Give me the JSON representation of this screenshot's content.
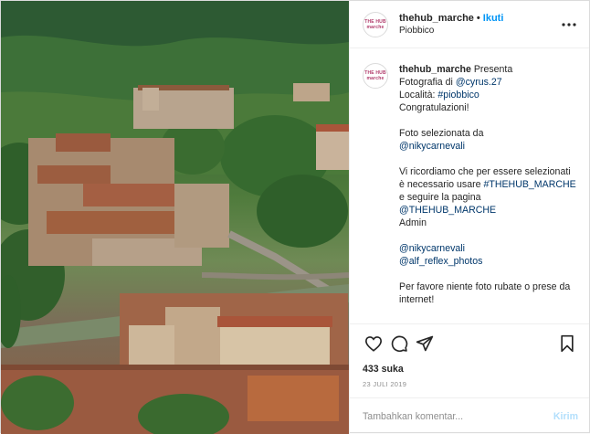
{
  "photo": {
    "alt": "Piobbico village photo"
  },
  "header": {
    "username": "thehub_marche",
    "separator": "•",
    "follow_label": "Ikuti",
    "location": "Piobbico",
    "avatar_text": "THE HUB marche"
  },
  "caption": {
    "username": "thehub_marche",
    "lines": [
      "Presenta",
      "Fotografia di ",
      "@cyrus.27",
      "Località: ",
      "#piobbico",
      "Congratulazioni!",
      "Foto selezionata da",
      "@nikycarnevali",
      "Vi ricordiamo che per essere selezionati è necessario usare",
      "#THEHUB_MARCHE",
      " e seguire la pagina ",
      "@THEHUB_MARCHE",
      "Admin",
      "@nikycarnevali",
      "@alf_reflex_photos",
      "Per favore niente foto rubate o prese da internet!"
    ]
  },
  "actions": {
    "like_icon": "heart-icon",
    "comment_icon": "comment-icon",
    "share_icon": "share-icon",
    "save_icon": "bookmark-icon"
  },
  "likes": "433 suka",
  "date": "23 JULI 2019",
  "comment_box": {
    "placeholder": "Tambahkan komentar...",
    "post_label": "Kirim"
  }
}
